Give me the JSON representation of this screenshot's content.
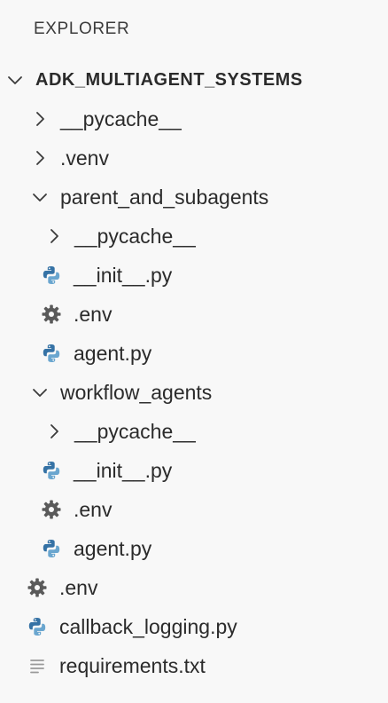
{
  "panel": {
    "title": "EXPLORER"
  },
  "tree": {
    "root": "ADK_MULTIAGENT_SYSTEMS",
    "items": [
      {
        "label": "__pycache__"
      },
      {
        "label": ".venv"
      },
      {
        "label": "parent_and_subagents"
      },
      {
        "label": "__pycache__"
      },
      {
        "label": "__init__.py"
      },
      {
        "label": ".env"
      },
      {
        "label": "agent.py"
      },
      {
        "label": "workflow_agents"
      },
      {
        "label": "__pycache__"
      },
      {
        "label": "__init__.py"
      },
      {
        "label": ".env"
      },
      {
        "label": "agent.py"
      },
      {
        "label": ".env"
      },
      {
        "label": "callback_logging.py"
      },
      {
        "label": "requirements.txt"
      }
    ]
  },
  "icons": {
    "chevron_right": "chevron-right-icon",
    "chevron_down": "chevron-down-icon",
    "python": "python-icon",
    "gear": "gear-icon",
    "text_file": "text-file-icon"
  },
  "colors": {
    "background": "#f8f8f8",
    "text": "#2b2b2b",
    "python_blue": "#3572a5",
    "python_light": "#6aa6cf",
    "gear": "#5a5a5a",
    "text_file": "#9a9a9a"
  }
}
